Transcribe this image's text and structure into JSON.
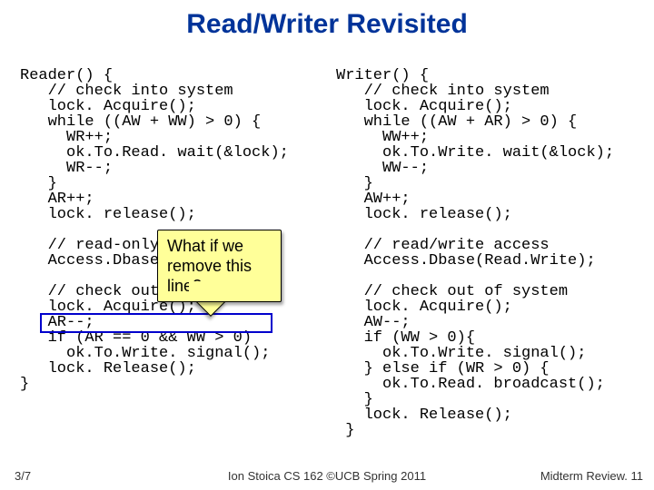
{
  "title": "Read/Writer Revisited",
  "code": {
    "left": "Reader() {\n   // check into system\n   lock. Acquire();\n   while ((AW + WW) > 0) {\n     WR++;\n     ok.To.Read. wait(&lock);\n     WR--;\n   }\n   AR++;\n   lock. release();\n\n   // read-only access\n   Access.Dbase(Read. Only);\n\n   // check out of system\n   lock. Acquire();\n   AR--;\n   if (AR == 0 && WW > 0)\n     ok.To.Write. signal();\n   lock. Release();\n}",
    "right": "Writer() {\n   // check into system\n   lock. Acquire();\n   while ((AW + AR) > 0) {\n     WW++;\n     ok.To.Write. wait(&lock);\n     WW--;\n   }\n   AW++;\n   lock. release();\n\n   // read/write access\n   Access.Dbase(Read.Write);\n\n   // check out of system\n   lock. Acquire();\n   AW--;\n   if (WW > 0){\n     ok.To.Write. signal();\n   } else if (WR > 0) {\n     ok.To.Read. broadcast();\n   }\n   lock. Release();\n }"
  },
  "callout": {
    "line1": "What if we",
    "line2": "remove this",
    "line3": "line?"
  },
  "footer": {
    "left": "3/7",
    "center": "Ion Stoica CS 162 ©UCB Spring 2011",
    "right": "Midterm Review. 11"
  },
  "colors": {
    "title": "#003399",
    "highlight_border": "#0000cc",
    "callout_bg": "#ffff99"
  },
  "highlight_target": "if (AR == 0 && WW > 0)"
}
